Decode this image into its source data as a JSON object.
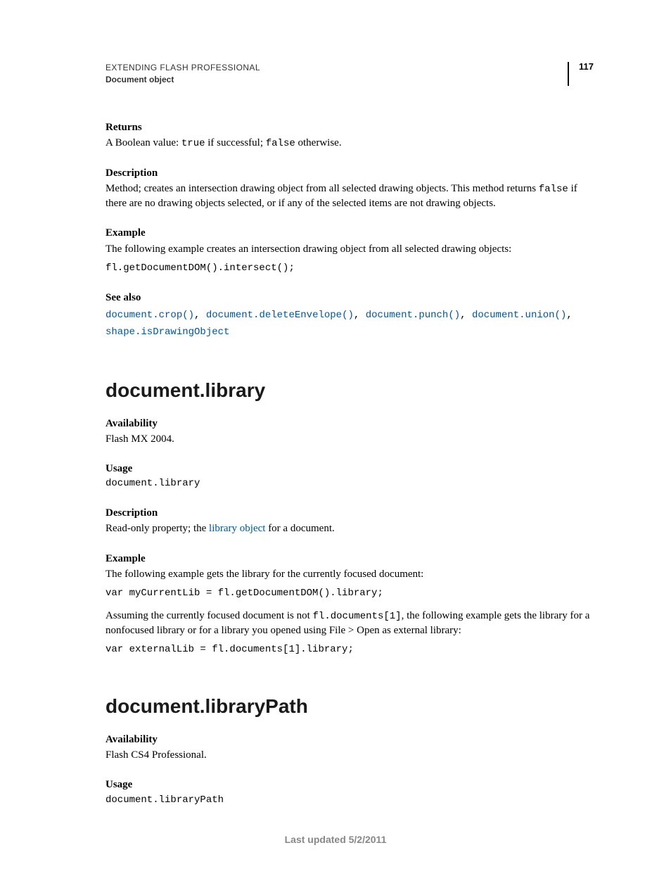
{
  "header": {
    "title": "EXTENDING FLASH PROFESSIONAL",
    "section": "Document object",
    "page_number": "117"
  },
  "intersect": {
    "returns_label": "Returns",
    "returns_pre": "A Boolean value: ",
    "returns_true": "true",
    "returns_mid": " if successful; ",
    "returns_false": "false",
    "returns_post": " otherwise.",
    "description_label": "Description",
    "description_pre": "Method; creates an intersection drawing object from all selected drawing objects. This method returns ",
    "description_code": "false",
    "description_post": " if there are no drawing objects selected, or if any of the selected items are not drawing objects.",
    "example_label": "Example",
    "example_text": "The following example creates an intersection drawing object from all selected drawing objects:",
    "example_code": "fl.getDocumentDOM().intersect();",
    "seealso_label": "See also",
    "seealso": {
      "l1": "document.crop()",
      "l2": "document.deleteEnvelope()",
      "l3": "document.punch()",
      "l4": "document.union()",
      "l5": "shape.isDrawingObject"
    }
  },
  "library": {
    "heading": "document.library",
    "availability_label": "Availability",
    "availability_text": "Flash MX 2004.",
    "usage_label": "Usage",
    "usage_code": "document.library",
    "description_label": "Description",
    "description_pre": "Read-only property; the ",
    "description_link": "library object",
    "description_post": " for a document.",
    "example_label": "Example",
    "example_text1": "The following example gets the library for the currently focused document:",
    "example_code1": "var myCurrentLib = fl.getDocumentDOM().library;",
    "example_text2_pre": "Assuming the currently focused document is not ",
    "example_text2_code": "fl.documents[1]",
    "example_text2_post": ", the following example gets the library for a nonfocused library or for a library you opened using File > Open as external library:",
    "example_code2": "var externalLib = fl.documents[1].library;"
  },
  "libraryPath": {
    "heading": "document.libraryPath",
    "availability_label": "Availability",
    "availability_text": "Flash CS4 Professional.",
    "usage_label": "Usage",
    "usage_code": "document.libraryPath"
  },
  "footer": {
    "text": "Last updated 5/2/2011"
  }
}
